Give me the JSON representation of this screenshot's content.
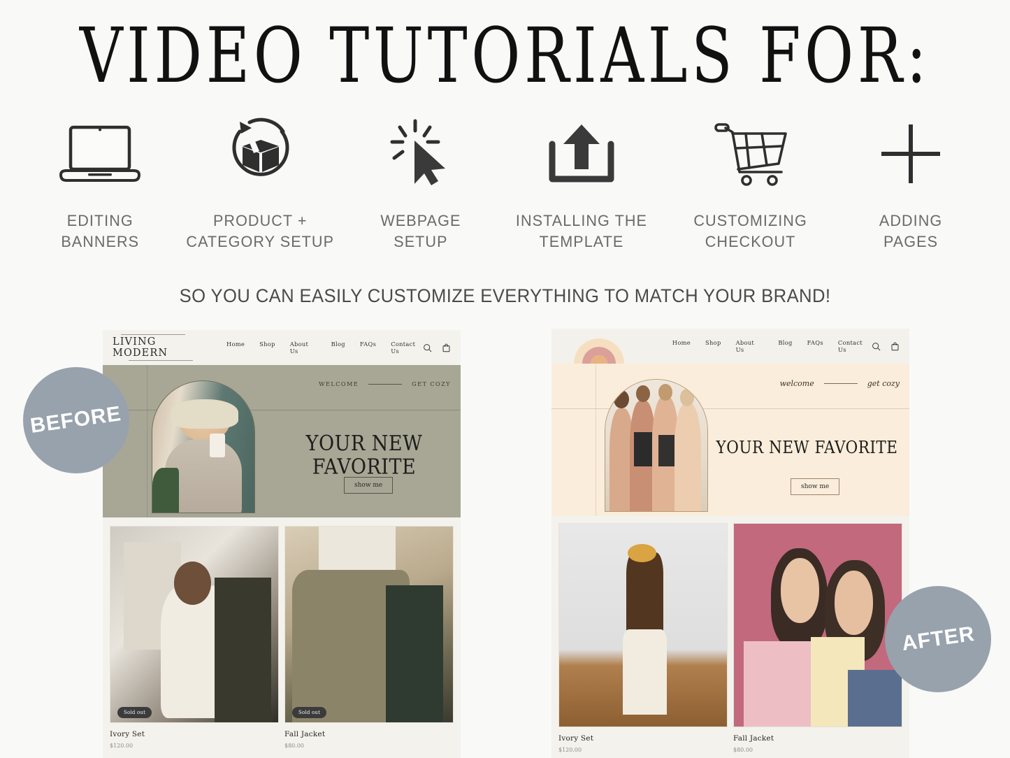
{
  "heading": "VIDEO TUTORIALS FOR:",
  "tagline": "SO YOU CAN EASILY CUSTOMIZE EVERYTHING TO MATCH YOUR BRAND!",
  "features": [
    {
      "icon": "laptop-icon",
      "line1": "EDITING",
      "line2": "BANNERS"
    },
    {
      "icon": "box-refresh-icon",
      "line1": "PRODUCT +",
      "line2": "CATEGORY SETUP"
    },
    {
      "icon": "click-cursor-icon",
      "line1": "WEBPAGE",
      "line2": "SETUP"
    },
    {
      "icon": "upload-icon",
      "line1": "INSTALLING THE",
      "line2": "TEMPLATE"
    },
    {
      "icon": "shopping-cart-icon",
      "line1": "CUSTOMIZING",
      "line2": "CHECKOUT"
    },
    {
      "icon": "plus-icon",
      "line1": "ADDING",
      "line2": "PAGES"
    }
  ],
  "badges": {
    "before": "BEFORE",
    "after": "AFTER",
    "color": "#97a2ac"
  },
  "before_mockup": {
    "logo": "LIVING MODERN",
    "nav": [
      "Home",
      "Shop",
      "About Us",
      "Blog",
      "FAQs",
      "Contact Us"
    ],
    "hero": {
      "eyebrow_left": "WELCOME",
      "eyebrow_right": "GET COZY",
      "title": "YOUR NEW FAVORITE",
      "button": "show me",
      "background_color": "#a8a796"
    },
    "products": [
      {
        "name": "Ivory Set",
        "price": "$120.00",
        "badge": "Sold out"
      },
      {
        "name": "Fall Jacket",
        "price": "$80.00",
        "badge": "Sold out"
      }
    ]
  },
  "after_mockup": {
    "logo": "rainbow-arch-logo",
    "nav": [
      "Home",
      "Shop",
      "About Us",
      "Blog",
      "FAQs",
      "Contact Us"
    ],
    "hero": {
      "eyebrow_left": "welcome",
      "eyebrow_right": "get cozy",
      "title": "YOUR NEW FAVORITE",
      "button": "show me",
      "background_color": "#faeddb"
    },
    "products": [
      {
        "name": "Ivory Set",
        "price": "$120.00",
        "badge": ""
      },
      {
        "name": "Fall Jacket",
        "price": "$80.00",
        "badge": ""
      }
    ]
  }
}
